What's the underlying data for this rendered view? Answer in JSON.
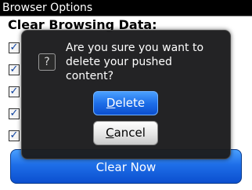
{
  "title_bar": {
    "title": "Browser Options"
  },
  "content": {
    "section_heading": "Clear Browsing Data:",
    "checkbox_mark": "✓",
    "clear_now_label": "Clear Now"
  },
  "dialog": {
    "icon_glyph": "?",
    "message_lines": [
      "Are you sure you want to",
      "delete your pushed",
      "content?"
    ],
    "delete_label": "Delete",
    "cancel_label": "Cancel"
  },
  "colors": {
    "title_bg": "#000000",
    "primary_button": "#1e6ee8",
    "dialog_bg": "#1c1c1e"
  }
}
